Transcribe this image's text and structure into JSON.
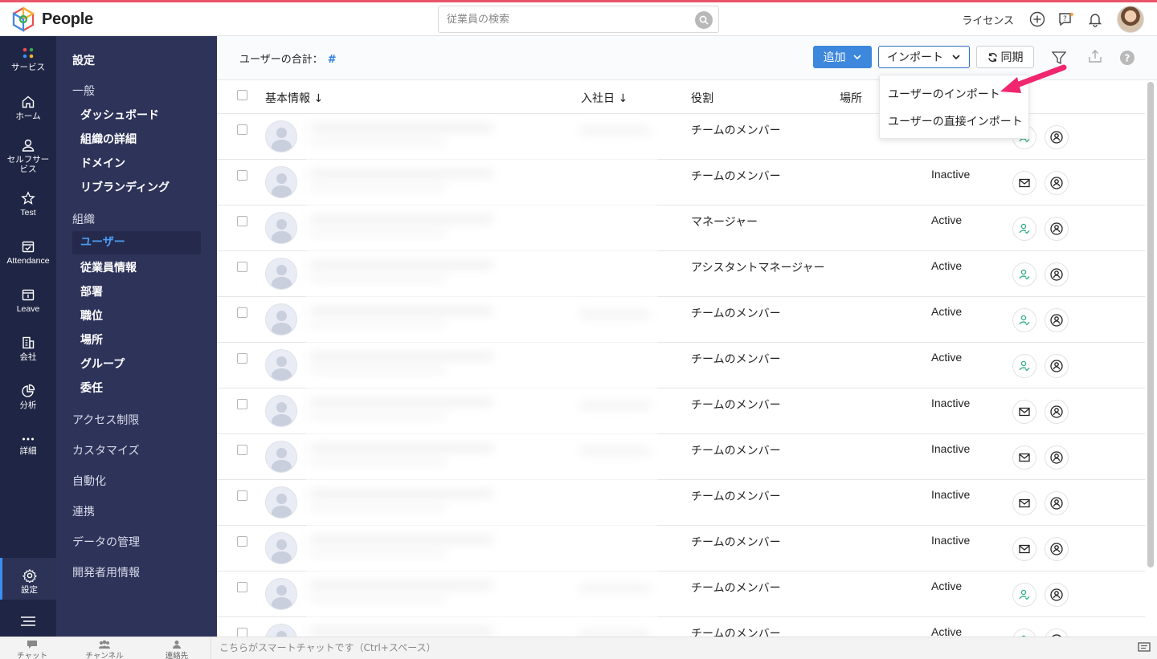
{
  "app": {
    "title": "People"
  },
  "search": {
    "placeholder": "従業員の検索"
  },
  "topbar": {
    "license": "ライセンス"
  },
  "rail": [
    {
      "label": "サービス",
      "icon": "services-dots-icon"
    },
    {
      "label": "ホーム",
      "icon": "home-icon"
    },
    {
      "label": "セルフサービス",
      "icon": "user-icon"
    },
    {
      "label": "Test",
      "icon": "star-icon"
    },
    {
      "label": "Attendance",
      "icon": "calendar-check-icon"
    },
    {
      "label": "Leave",
      "icon": "calendar-icon"
    },
    {
      "label": "会社",
      "icon": "building-icon"
    },
    {
      "label": "分析",
      "icon": "pie-chart-icon"
    },
    {
      "label": "詳細",
      "icon": "more-dots-icon"
    },
    {
      "label": "設定",
      "icon": "gear-icon"
    }
  ],
  "sidebar": {
    "title": "設定",
    "sections": {
      "general": "一般",
      "general_items": [
        "ダッシュボード",
        "組織の詳細",
        "ドメイン",
        "リブランディング"
      ],
      "org": "組織",
      "org_items": [
        "ユーザー",
        "従業員情報",
        "部署",
        "職位",
        "場所",
        "グループ",
        "委任"
      ],
      "more": [
        "アクセス制限",
        "カスタマイズ",
        "自動化",
        "連携",
        "データの管理",
        "開発者用情報"
      ]
    }
  },
  "toolbar": {
    "total_label": "ユーザーの合計：",
    "total_value": "#",
    "add": "追加",
    "import": "インポート",
    "sync": "同期"
  },
  "dropdown": {
    "items": [
      "ユーザーのインポート",
      "ユーザーの直接インポート"
    ]
  },
  "table": {
    "headers": {
      "basic": "基本情報 ↓",
      "join_date": "入社日 ↓",
      "role": "役割",
      "location": "場所"
    },
    "rows": [
      {
        "role": "チームのメンバー",
        "status": ""
      },
      {
        "role": "チームのメンバー",
        "status": "Inactive"
      },
      {
        "role": "マネージャー",
        "status": "Active"
      },
      {
        "role": "アシスタントマネージャー",
        "status": "Active"
      },
      {
        "role": "チームのメンバー",
        "status": "Active"
      },
      {
        "role": "チームのメンバー",
        "status": "Active"
      },
      {
        "role": "チームのメンバー",
        "status": "Inactive"
      },
      {
        "role": "チームのメンバー",
        "status": "Inactive"
      },
      {
        "role": "チームのメンバー",
        "status": "Inactive"
      },
      {
        "role": "チームのメンバー",
        "status": "Inactive"
      },
      {
        "role": "チームのメンバー",
        "status": "Active"
      },
      {
        "role": "チームのメンバー",
        "status": "Active"
      }
    ]
  },
  "bottombar": {
    "chat": "チャット",
    "channel": "チャンネル",
    "contacts": "連絡先",
    "smart_chat": "こちらがスマートチャットです（Ctrl+スペース）"
  },
  "colors": {
    "accent": "#3d87dd",
    "sidebar": "#2e335a",
    "rail": "#1f2544",
    "active_link": "#4a9cf5",
    "arrow": "#f0266f",
    "top_border": "#e8556b"
  }
}
